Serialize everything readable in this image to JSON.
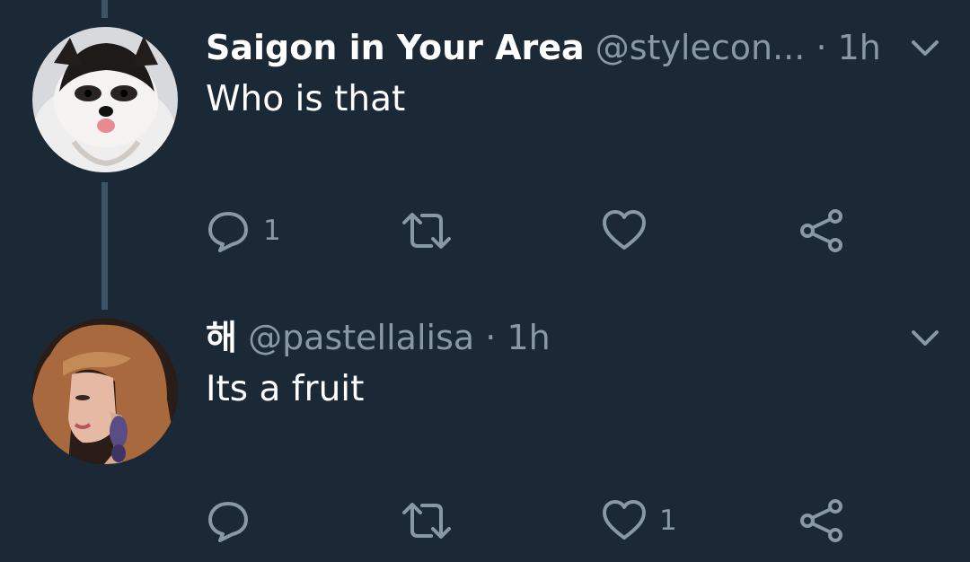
{
  "tweets": [
    {
      "display_name": "Saigon in Your Area",
      "handle": "@stylecon...",
      "separator": "·",
      "time": "1h",
      "text": "Who is that",
      "avatar": "pomeranian-dog-avatar",
      "actions": {
        "reply_count": "1",
        "retweet_count": "",
        "like_count": ""
      }
    },
    {
      "display_name": "해",
      "handle": "@pastellalisa",
      "separator": "·",
      "time": "1h",
      "text": "Its a fruit",
      "avatar": "woman-portrait-avatar",
      "actions": {
        "reply_count": "",
        "retweet_count": "",
        "like_count": "1"
      }
    }
  ],
  "icons": {
    "reply": "reply-icon",
    "retweet": "retweet-icon",
    "like": "heart-icon",
    "share": "share-icon",
    "menu": "chevron-down-icon"
  },
  "colors": {
    "background": "#1b2836",
    "thread_line": "#3d5466",
    "secondary_text": "#8899a6",
    "primary_text": "#ffffff"
  }
}
